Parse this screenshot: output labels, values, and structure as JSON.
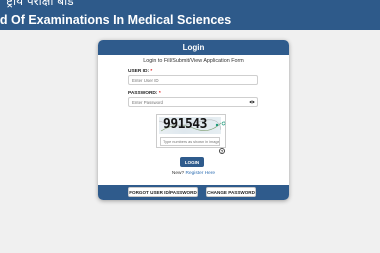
{
  "banner": {
    "hindi_title": "ष्ट्रीय परीक्षा बोर्ड",
    "english_title": "rd Of Examinations In Medical Sciences"
  },
  "login_card": {
    "header": "Login",
    "subtitle": "Login to Fill/Submit/View Application Form",
    "user_id_label": "USER ID:",
    "user_id_placeholder": "Enter User ID",
    "password_label": "PASSWORD:",
    "password_placeholder": "Enter Password",
    "required_mark": "*",
    "captcha": {
      "code": "991543",
      "input_placeholder": "Type numbers as shown in image"
    },
    "help_glyph": "?",
    "login_button": "LOGIN",
    "new_prefix": "New?",
    "register_link": "Register Here",
    "forgot_button": "FORGOT USER ID/PASSWORD",
    "change_password_button": "CHANGE PASSWORD"
  },
  "icons": {
    "eye": "eye-icon",
    "refresh": "refresh-icon",
    "help": "help-icon"
  },
  "colors": {
    "primary": "#2f5b8c",
    "banner": "#2e5a8a",
    "required": "#d11111",
    "link": "#2f6fb3",
    "page_background": "#f0f0f0"
  }
}
